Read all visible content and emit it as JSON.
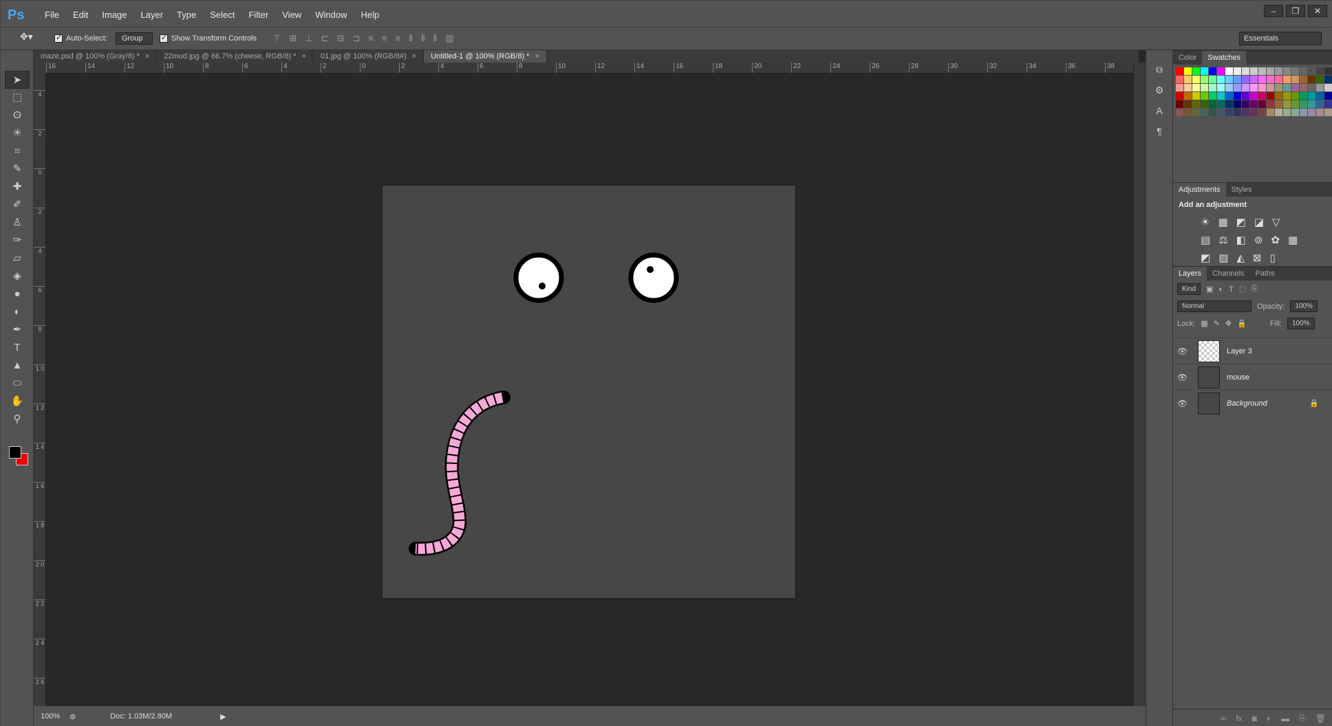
{
  "app": {
    "logo": "Ps",
    "name": "Photoshop"
  },
  "menu": [
    "File",
    "Edit",
    "Image",
    "Layer",
    "Type",
    "Select",
    "Filter",
    "View",
    "Window",
    "Help"
  ],
  "window_controls": [
    "–",
    "❐",
    "✕"
  ],
  "options": {
    "auto_select_label": "Auto-Select:",
    "auto_select_value": "Group",
    "show_transform_label": "Show Transform Controls",
    "workspace": "Essentials"
  },
  "tabs": [
    {
      "label": "maze.psd @ 100% (Gray/8) *"
    },
    {
      "label": "22mud.jpg @ 66.7% (cheese, RGB/8) *"
    },
    {
      "label": "01.jpg @ 100% (RGB/8#)"
    },
    {
      "label": "Untitled-1 @ 100% (RGB/8) *",
      "active": true
    }
  ],
  "ruler_h": [
    "16",
    "14",
    "12",
    "10",
    "8",
    "6",
    "4",
    "2",
    "0",
    "2",
    "4",
    "6",
    "8",
    "10",
    "12",
    "14",
    "16",
    "18",
    "20",
    "22",
    "24",
    "26",
    "28",
    "30",
    "32",
    "34",
    "36",
    "38"
  ],
  "ruler_v": [
    "4",
    "2",
    "0",
    "2",
    "4",
    "6",
    "8",
    "1 0",
    "1 2",
    "1 4",
    "1 6",
    "1 8",
    "2 0",
    "2 2",
    "2 4",
    "2 6"
  ],
  "status": {
    "zoom": "100%",
    "doc": "Doc: 1.03M/2.80M"
  },
  "swatch_panel": {
    "tabs": [
      "Color",
      "Swatches"
    ]
  },
  "adjustments": {
    "tabs": [
      "Adjustments",
      "Styles"
    ],
    "title": "Add an adjustment"
  },
  "layers_panel": {
    "tabs": [
      "Layers",
      "Channels",
      "Paths"
    ],
    "kind": "Kind",
    "blend_mode": "Normal",
    "opacity_label": "Opacity:",
    "opacity_value": "100%",
    "lock_label": "Lock:",
    "fill_label": "Fill:",
    "fill_value": "100%",
    "layers": [
      {
        "name": "Layer 3"
      },
      {
        "name": "mouse"
      },
      {
        "name": "Background"
      }
    ]
  },
  "colors": {
    "foreground": "#000000",
    "background": "#e00000",
    "canvas": "#474747",
    "tail": "#f7a8d8"
  }
}
